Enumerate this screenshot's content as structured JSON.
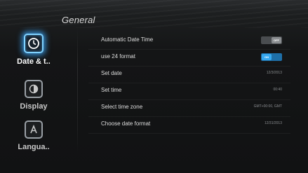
{
  "header": {
    "title": "General"
  },
  "sidebar": {
    "items": [
      {
        "label": "Date & t..",
        "icon": "clock-icon",
        "active": true
      },
      {
        "label": "Display",
        "icon": "display-icon",
        "active": false
      },
      {
        "label": "Langua..",
        "icon": "language-icon",
        "active": false
      }
    ]
  },
  "settings": {
    "automatic_date_time": {
      "label": "Automatic Date Time",
      "toggle_text": "OFF",
      "state": "off"
    },
    "use_24_format": {
      "label": "use 24 format",
      "toggle_text": "ON",
      "state": "on"
    },
    "set_date": {
      "label": "Set date",
      "value": "12/3/2013"
    },
    "set_time": {
      "label": "Set time",
      "value": "00:40"
    },
    "select_time_zone": {
      "label": "Select time zone",
      "value": "GMT+00:00, GMT"
    },
    "choose_date_format": {
      "label": "Choose date format",
      "value": "12/31/2013"
    }
  },
  "colors": {
    "accent": "#36a8ef",
    "glow": "#3caaff",
    "background": "#111213"
  }
}
